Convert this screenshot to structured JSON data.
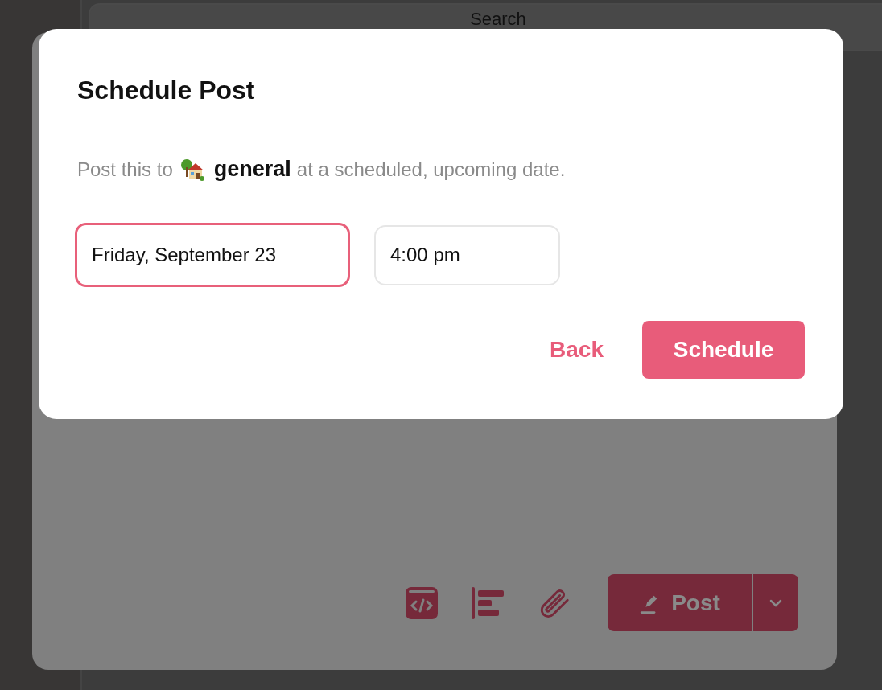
{
  "background": {
    "search": {
      "placeholder": "Search"
    },
    "toolbar": {
      "tools": [
        {
          "kind": "embed"
        },
        {
          "kind": "align"
        },
        {
          "kind": "attach"
        }
      ],
      "post_button": {
        "label": "Post"
      }
    }
  },
  "dialog": {
    "title": "Schedule Post",
    "description": {
      "before": "Post this to",
      "channel": "general",
      "after": "at a scheduled, upcoming date."
    },
    "date_field": {
      "value": "Friday, September 23",
      "focused": true
    },
    "time_field": {
      "value": "4:00 pm",
      "focused": false
    },
    "buttons": [
      {
        "kind": "link",
        "label": "Back"
      },
      {
        "kind": "primary",
        "label": "Schedule"
      }
    ]
  }
}
